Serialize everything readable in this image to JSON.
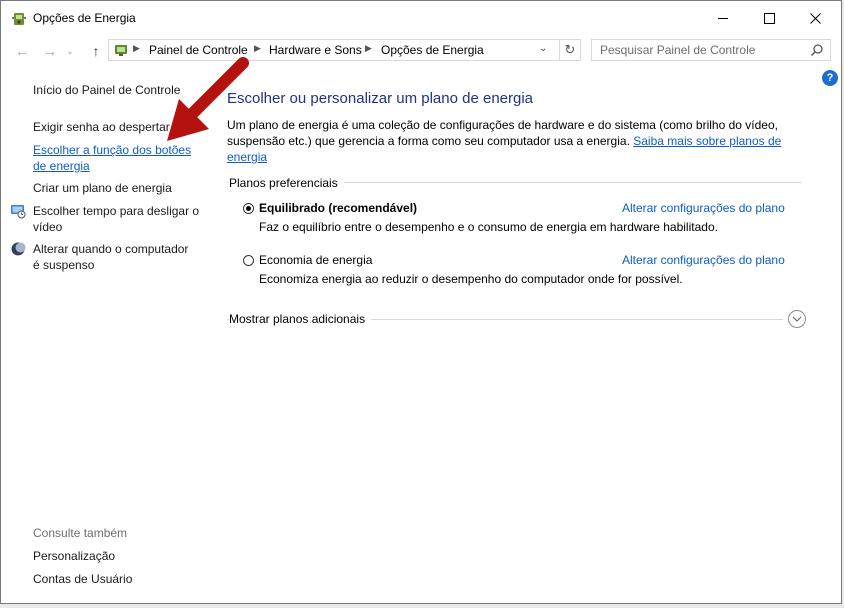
{
  "window": {
    "title": "Opções de Energia",
    "minimize_icon": "minimize-icon",
    "maximize_icon": "maximize-icon",
    "close_icon": "close-icon"
  },
  "navigation": {
    "breadcrumbs": [
      "Painel de Controle",
      "Hardware e Sons",
      "Opções de Energia"
    ],
    "search_placeholder": "Pesquisar Painel de Controle"
  },
  "sidebar": {
    "home": "Início do Painel de Controle",
    "tasks": [
      {
        "label": "Exigir senha ao despertar"
      },
      {
        "label_line1": "Escolher a função dos botões",
        "label_line2": "de energia"
      },
      {
        "label": "Criar um plano de energia"
      },
      {
        "label_line1": "Escolher tempo para desligar o",
        "label_line2": "vídeo",
        "icon": "display-clock-icon"
      },
      {
        "label_line1": "Alterar quando o computador",
        "label_line2": "é suspenso",
        "icon": "moon-icon"
      }
    ],
    "see_also": {
      "heading": "Consulte também",
      "links": [
        "Personalização",
        "Contas de Usuário"
      ]
    }
  },
  "main": {
    "title": "Escolher ou personalizar um plano de energia",
    "description_line1": "Um plano de energia é uma coleção de configurações de hardware e do sistema (como brilho do vídeo,",
    "description_line2": "suspensão etc.) que gerencia a forma como seu computador usa a energia.",
    "learn_more_link": "Saiba mais sobre planos de energia",
    "preferred_plans_label": "Planos preferenciais",
    "plans": [
      {
        "name": "Equilibrado (recomendável)",
        "description": "Faz o equilíbrio entre o desempenho e o consumo de energia em hardware habilitado.",
        "change_link": "Alterar configurações do plano",
        "selected": true
      },
      {
        "name": "Economia de energia",
        "description": "Economiza energia ao reduzir o desempenho do computador onde for possível.",
        "change_link": "Alterar configurações do plano",
        "selected": false
      }
    ],
    "additional_plans_label": "Mostrar planos adicionais"
  },
  "colors": {
    "link": "#0f5bc8",
    "title": "#1e3287",
    "arrow": "#b3120f"
  }
}
